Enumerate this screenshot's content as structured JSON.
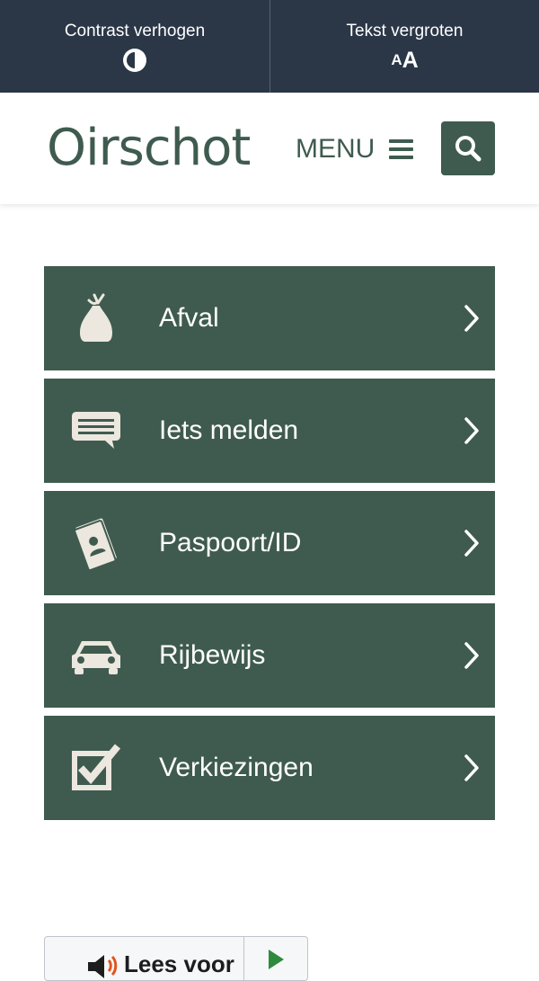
{
  "topbar": {
    "contrast_label": "Contrast verhogen",
    "textsize_label": "Tekst vergroten",
    "textsize_icon_small": "A",
    "textsize_icon_big": "A"
  },
  "header": {
    "logo_text": "Oirschot",
    "menu_label": "MENU",
    "search_icon": "search-icon"
  },
  "tiles": [
    {
      "label": "Afval",
      "icon": "waste-bag-icon"
    },
    {
      "label": "Iets melden",
      "icon": "speech-bubble-icon"
    },
    {
      "label": "Paspoort/ID",
      "icon": "passport-icon"
    },
    {
      "label": "Rijbewijs",
      "icon": "car-icon"
    },
    {
      "label": "Verkiezingen",
      "icon": "ballot-checkbox-icon"
    }
  ],
  "readspeaker": {
    "label": "Lees voor",
    "icon": "speaker-icon",
    "play_icon": "play-icon"
  },
  "colors": {
    "topbar_bg": "#2b3747",
    "brand_green": "#3f5b4f",
    "icon_cream": "#ece7df"
  }
}
